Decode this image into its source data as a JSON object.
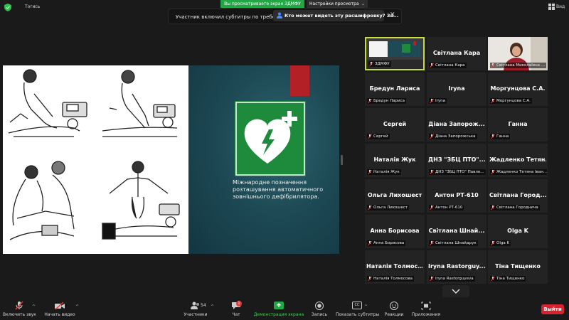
{
  "top_bar": {
    "lock_label": "Тогись",
    "share_banner": "Вы просматриваете экран ЗДМФУ",
    "view_options": "Настройки просмотра",
    "view_label": "Вид"
  },
  "notification": {
    "text": "Участник включил субтитры по требованию",
    "link": "Кто может видеть эту расшифровку? За...",
    "close": "✕"
  },
  "slide": {
    "caption": "Міжнародне позначення розташування автоматичного зовнішнього дефібрилятора.",
    "colors": {
      "aed_green": "#1e8a3c",
      "red_tab": "#b32026",
      "bg_dark": "#1d4a55"
    }
  },
  "gallery": {
    "tiles": [
      {
        "name": "",
        "label": "ЗДМФУ",
        "self": true
      },
      {
        "name": "Світлана Кара",
        "label": "Світлана Кара"
      },
      {
        "name": "",
        "label": "Світлана Миколаївна ...",
        "photo": true
      },
      {
        "name": "Бредун Лариса",
        "label": "Бредун Лариса"
      },
      {
        "name": "Iryna",
        "label": "Iryna"
      },
      {
        "name": "Моргунцова С.А.",
        "label": "Моргунцова С.А."
      },
      {
        "name": "Сергей",
        "label": "Сергей"
      },
      {
        "name": "Діана Запорож...",
        "label": "Діана Запорожська"
      },
      {
        "name": "Ганна",
        "label": "Ганна"
      },
      {
        "name": "Наталія Жук",
        "label": "Наталія Жук"
      },
      {
        "name": "ДНЗ \"ЗБЦ ПТО\"...",
        "label": "ДНЗ \"ЗБЦ ПТО\" Павле..."
      },
      {
        "name": "Жадленко Тетян...",
        "label": "Жадленко Тетяна Іван..."
      },
      {
        "name": "Ольга Лихошест",
        "label": "Ольга Лихошест"
      },
      {
        "name": "Антон РТ-610",
        "label": "Антон РТ-610"
      },
      {
        "name": "Світлана Город...",
        "label": "Світлана Городнича"
      },
      {
        "name": "Анна Борисова",
        "label": "Анна Борисова"
      },
      {
        "name": "Світлана Шнай...",
        "label": "Світлана Шнайдрук"
      },
      {
        "name": "Olga K",
        "label": "Olga K"
      },
      {
        "name": "Наталія Толмос...",
        "label": "Наталія Толмосова"
      },
      {
        "name": "Iryna Rastorguy...",
        "label": "Iryna Rastorguyeva"
      },
      {
        "name": "Тіна Тищенко",
        "label": "Тіна Тищенко"
      }
    ]
  },
  "toolbar": {
    "audio": "Включить звук",
    "video": "Начать видео",
    "participants": "Участники",
    "participants_count": "54",
    "chat": "Чат",
    "chat_badge": "1",
    "share": "Демонстрация экрана",
    "record": "Запись",
    "captions": "Показать субтитры",
    "captions_icon": "CC",
    "reactions": "Реакции",
    "apps": "Приложения",
    "leave": "Выйти"
  }
}
